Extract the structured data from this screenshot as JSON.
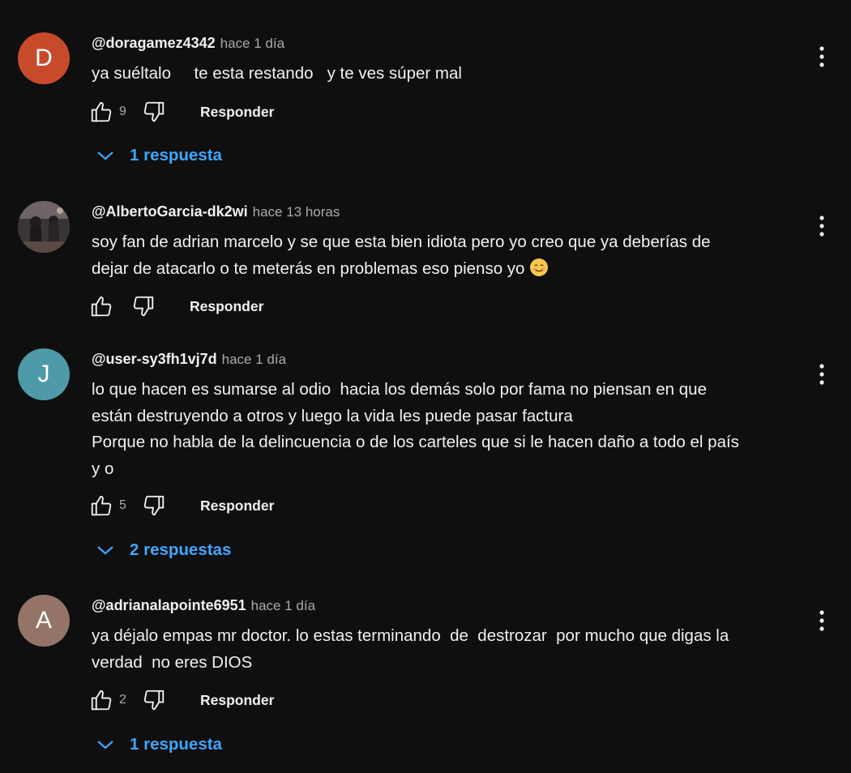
{
  "comments": [
    {
      "avatar_letter": "D",
      "avatar_color": "#c74b2a",
      "author": "@doragamez4342",
      "time": "hace 1 día",
      "text": [
        "ya suéltalo     te esta restando   y te ves súper mal"
      ],
      "likes": "9",
      "reply_label": "Responder",
      "replies_label": "1 respuesta"
    },
    {
      "avatar_letter": "",
      "avatar_color": "#4a4247",
      "author": "@AlbertoGarcia-dk2wi",
      "time": "hace 13 horas",
      "text": [
        "soy fan de adrian marcelo y se que esta bien idiota pero yo creo que ya deberías de",
        "dejar de atacarlo o te meterás en problemas eso pienso yo"
      ],
      "emoji": "😊",
      "likes": "",
      "reply_label": "Responder",
      "replies_label": ""
    },
    {
      "avatar_letter": "J",
      "avatar_color": "#4e9aa9",
      "author": "@user-sy3fh1vj7d",
      "time": "hace 1 día",
      "text": [
        "lo que hacen es sumarse al odio  hacia los demás solo por fama no piensan en que",
        "están destruyendo a otros y luego la vida les puede pasar factura",
        "Porque no habla de la delincuencia o de los carteles que si le hacen daño a todo el país",
        "y o"
      ],
      "likes": "5",
      "reply_label": "Responder",
      "replies_label": "2 respuestas"
    },
    {
      "avatar_letter": "A",
      "avatar_color": "#937466",
      "author": "@adrianalapointe6951",
      "time": "hace 1 día",
      "text": [
        "ya déjalo empas mr doctor. lo estas terminando  de  destrozar  por mucho que digas la",
        "verdad  no eres DIOS"
      ],
      "likes": "2",
      "reply_label": "Responder",
      "replies_label": "1 respuesta"
    }
  ],
  "icons": {
    "like": "thumbs-up-icon",
    "dislike": "thumbs-down-icon",
    "menu": "more-vert-icon",
    "expand": "chevron-down-icon"
  },
  "colors": {
    "background": "#0f0f0f",
    "text": "#f1f1f1",
    "secondary_text": "#aaaaaa",
    "link": "#3ea6ff"
  }
}
